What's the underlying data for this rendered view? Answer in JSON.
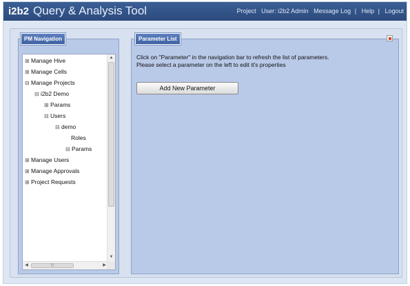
{
  "header": {
    "logo": "i2b2",
    "title": "Query & Analysis Tool",
    "nav": {
      "project": "Project",
      "user": "User: i2b2 Admin",
      "message_log": "Message Log",
      "help": "Help",
      "logout": "Logout",
      "separator": "|"
    }
  },
  "pm_navigation": {
    "tab_label": "PM Navigation",
    "tree": [
      {
        "label": "Manage Hive",
        "toggle": "⊞"
      },
      {
        "label": "Manage Cells",
        "toggle": "⊞"
      },
      {
        "label": "Manage Projects",
        "toggle": "⊟"
      },
      {
        "label": "i2b2 Demo",
        "toggle": "⊟"
      },
      {
        "label": "Params",
        "toggle": "⊞"
      },
      {
        "label": "Users",
        "toggle": "⊟"
      },
      {
        "label": "demo",
        "toggle": "⊟"
      },
      {
        "label": "Roles",
        "toggle": ""
      },
      {
        "label": "Params",
        "toggle": "⊟"
      },
      {
        "label": "Manage Users",
        "toggle": "⊞"
      },
      {
        "label": "Manage Approvals",
        "toggle": "⊞"
      },
      {
        "label": "Project Requests",
        "toggle": "⊞"
      }
    ],
    "scroll_up": "▲",
    "scroll_down": "▼",
    "scroll_left": "◀",
    "scroll_right": "▶",
    "scroll_grip": "|||"
  },
  "parameter_list": {
    "tab_label": "Parameter List",
    "instruction_1": "Click on \"Parameter\" in the navigation bar to refresh the list of parameters.",
    "instruction_2": "Please select a parameter on the left to edit it's properties",
    "add_button": "Add New Parameter"
  },
  "colors": {
    "header": "#2f5288",
    "panel": "#b9c9e8",
    "tab": "#4a6cae",
    "background": "#dde6f3"
  }
}
